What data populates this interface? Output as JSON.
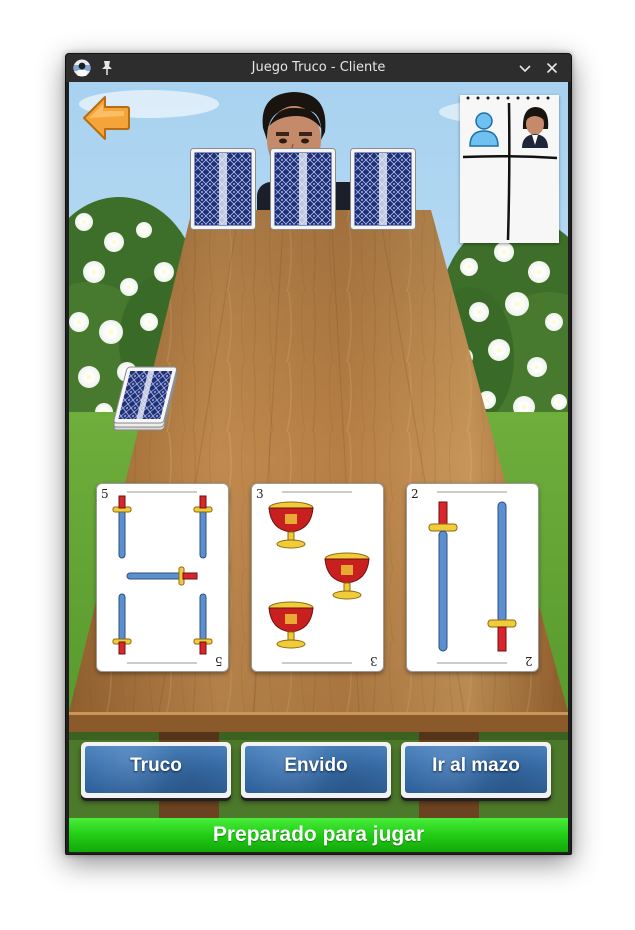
{
  "window": {
    "title": "Juego Truco - Cliente"
  },
  "icons": {
    "app": "app-icon",
    "pin": "pin-icon",
    "minimize": "chevron-down-icon",
    "close": "close-icon",
    "back": "back-arrow-icon",
    "player": "player-avatar-icon",
    "opponent": "opponent-avatar-icon"
  },
  "opponent": {
    "cards_face_down": 3
  },
  "hand": [
    {
      "number": "5",
      "suit": "espadas"
    },
    {
      "number": "3",
      "suit": "copas"
    },
    {
      "number": "2",
      "suit": "espadas"
    }
  ],
  "actions": {
    "truco": "Truco",
    "envido": "Envido",
    "mazo": "Ir al mazo"
  },
  "status": {
    "text": "Preparado para jugar"
  },
  "colors": {
    "button_blue": "#3a70ad",
    "status_green": "#22cc15",
    "back_arrow": "#f5a43a",
    "table_wood": "#b07d44"
  }
}
